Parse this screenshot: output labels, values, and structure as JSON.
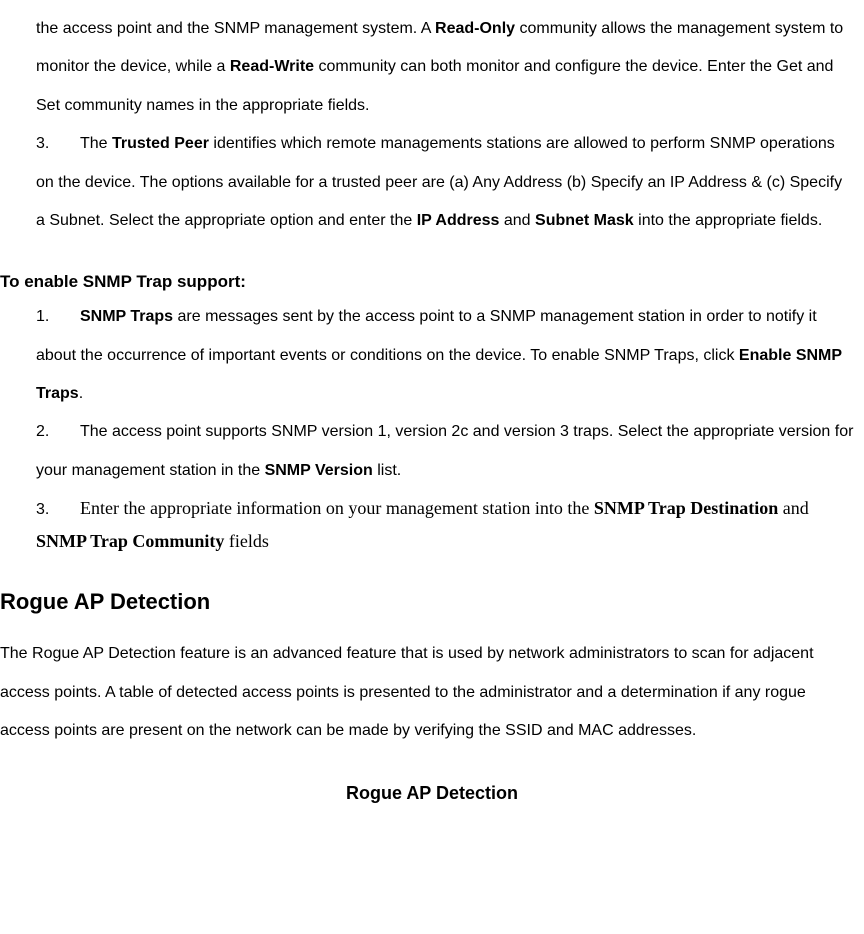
{
  "top": {
    "para_start": "the access point and the SNMP management system. A ",
    "read_only": "Read-Only",
    "mid1": " community allows the management system to monitor the device, while a ",
    "read_write": "Read-Write",
    "mid2": " community can both monitor and configure the device. Enter the Get and Set community names in the appropriate fields."
  },
  "item3": {
    "num": "3.",
    "pre": "The ",
    "trusted_peer": "Trusted Peer",
    "mid1": " identifies which remote managements stations are allowed to perform SNMP operations on the device. The options available for a trusted peer are (a) Any Address (b) Specify an IP Address & (c) Specify a Subnet. Select the appropriate option and enter the ",
    "ip_address": "IP Address",
    "and": " and ",
    "subnet_mask": "Subnet Mask",
    "tail": " into the appropriate fields."
  },
  "trap_heading": "To enable SNMP Trap support:",
  "trap1": {
    "num": "1.",
    "snmp_traps": "SNMP Traps",
    "mid": " are messages sent by the access point to a SNMP management station in order to notify it about the occurrence of important events or conditions on the device. To enable SNMP Traps, click ",
    "enable_snmp_traps": "Enable SNMP Traps",
    "period": "."
  },
  "trap2": {
    "num": "2.",
    "text_pre": "The access point supports SNMP version 1, version 2c and version 3 traps. Select the appropriate version for your management station in the ",
    "snmp_version": "SNMP Version",
    "text_post": " list."
  },
  "trap3": {
    "num": "3.",
    "pre": "Enter the appropriate information on your management station into the ",
    "dest": "SNMP Trap Destination",
    "and": " and ",
    "community": "SNMP Trap Community",
    "tail": " fields"
  },
  "rogue_heading": "Rogue AP Detection",
  "rogue_para": "The Rogue AP Detection feature is an advanced feature that is used by network administrators to scan for adjacent access points. A table of detected access points is presented to the administrator and a determination if any rogue access points are present on the network can be made by verifying the SSID and MAC addresses.",
  "rogue_centered": "Rogue AP Detection"
}
